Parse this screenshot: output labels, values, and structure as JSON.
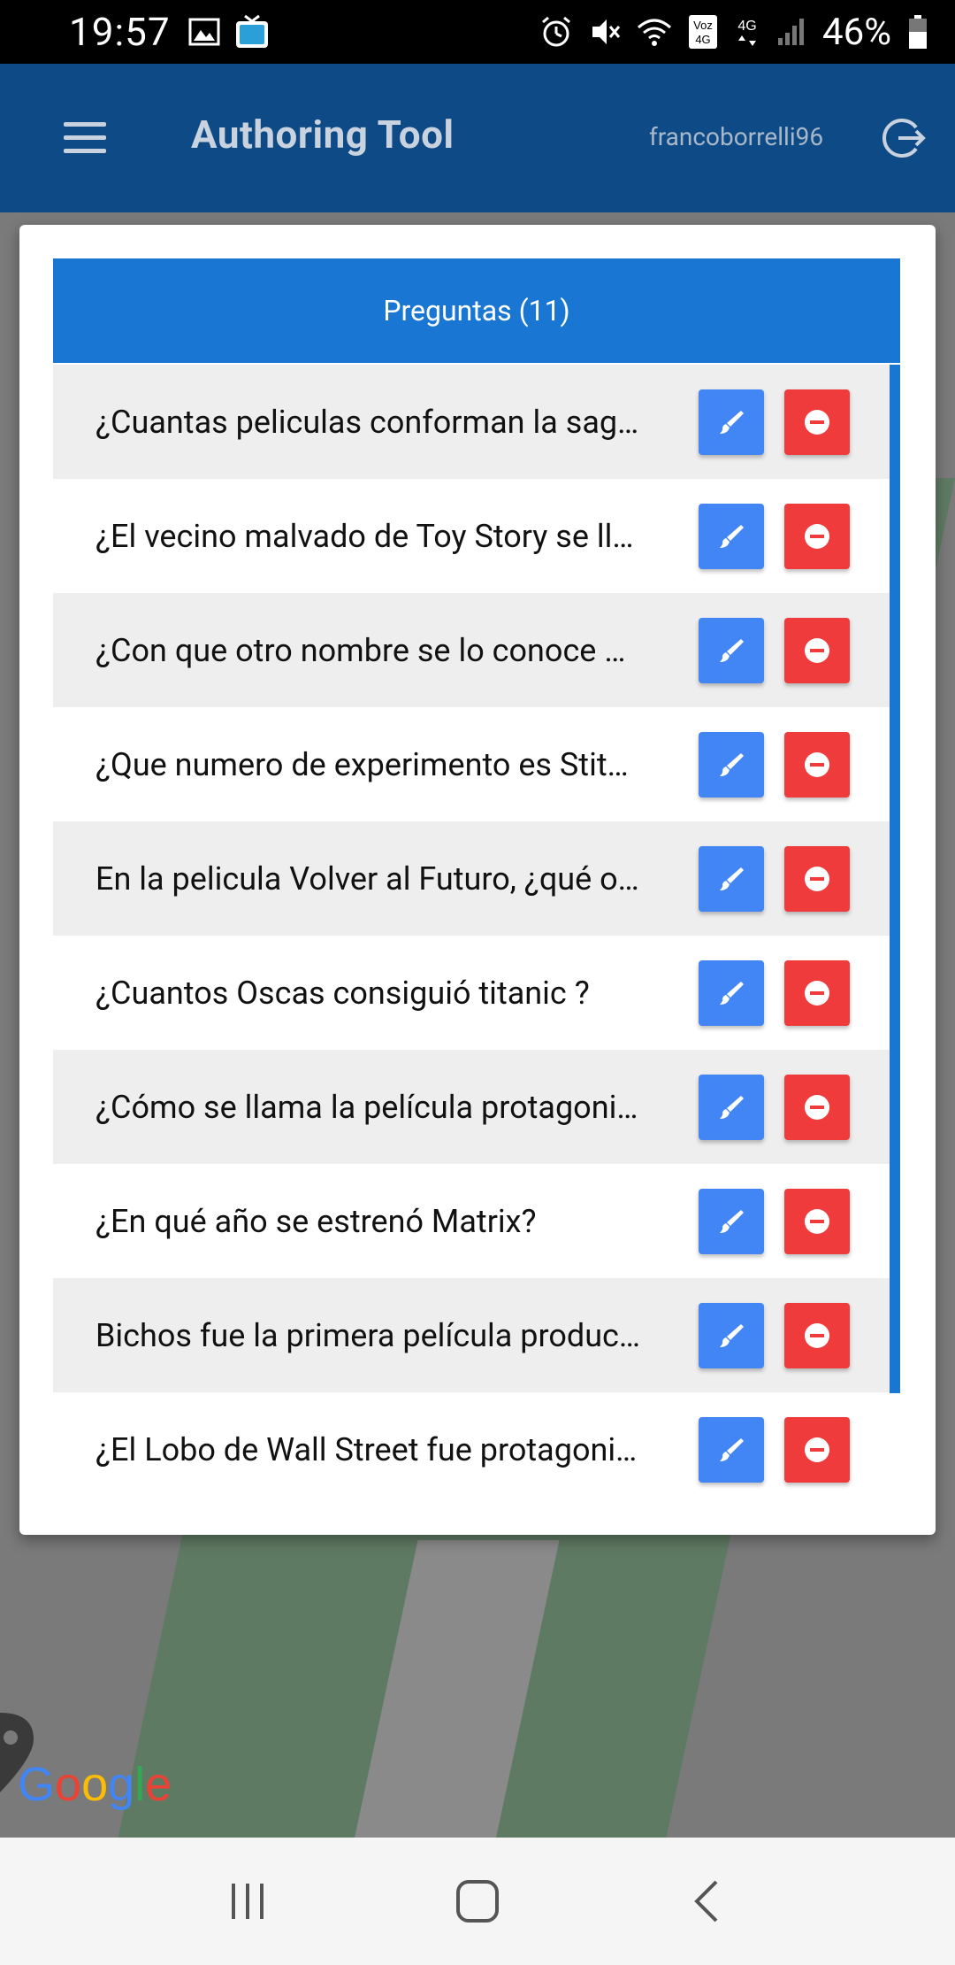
{
  "status_bar": {
    "time": "19:57",
    "battery": "46%",
    "left_icons": [
      "image-icon",
      "tv-app-icon"
    ],
    "right_icons": [
      "alarm-icon",
      "mute-icon",
      "wifi-icon",
      "volte-icon",
      "4g-icon",
      "signal-icon",
      "battery-icon"
    ],
    "volte_label": "Voz\n4G",
    "network_label": "4G"
  },
  "app_bar": {
    "title": "Authoring Tool",
    "username": "francoborrelli96",
    "menu_icon": "menu-icon",
    "logout_icon": "logout-icon"
  },
  "dialog": {
    "header": "Preguntas (11)",
    "questions": [
      {
        "text": "¿Cuantas peliculas conforman la sag…"
      },
      {
        "text": "¿El vecino malvado de Toy Story se ll…"
      },
      {
        "text": "¿Con que otro nombre se lo conoce …"
      },
      {
        "text": "¿Que numero de experimento es Stit…"
      },
      {
        "text": "En la pelicula Volver al Futuro, ¿qué o…"
      },
      {
        "text": "¿Cuantos Oscas consiguió titanic ?"
      },
      {
        "text": "¿Cómo se llama la película protagoni…"
      },
      {
        "text": "¿En qué año se estrenó Matrix?"
      },
      {
        "text": "Bichos fue la primera película produc…"
      },
      {
        "text": "¿El Lobo de Wall Street fue protagoni…"
      }
    ],
    "edit_icon": "brush-icon",
    "delete_icon": "remove-circle-icon"
  },
  "map": {
    "logo": "Google"
  },
  "colors": {
    "app_bar": "#0d4a86",
    "header": "#1976d2",
    "edit": "#4285f4",
    "delete": "#ef3b3b"
  }
}
